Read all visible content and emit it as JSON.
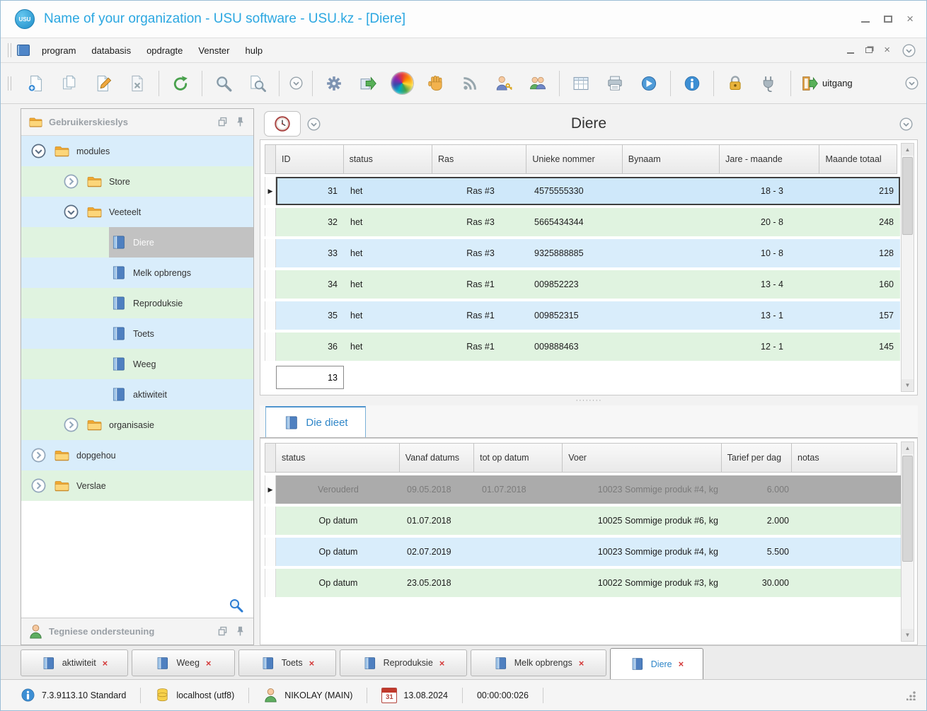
{
  "window": {
    "title": "Name of your organization - USU software - USU.kz - [Diere]",
    "logo_text": "USU"
  },
  "menubar": {
    "items": [
      "program",
      "databasis",
      "opdragte",
      "Venster",
      "hulp"
    ]
  },
  "toolbar": {
    "exit_label": "uitgang"
  },
  "sidebar": {
    "title": "Gebruikerskieslys",
    "support_title": "Tegniese ondersteuning",
    "tree": [
      {
        "label": "modules"
      },
      {
        "label": "Store"
      },
      {
        "label": "Veeteelt"
      },
      {
        "label": "Diere"
      },
      {
        "label": "Melk opbrengs"
      },
      {
        "label": "Reproduksie"
      },
      {
        "label": "Toets"
      },
      {
        "label": "Weeg"
      },
      {
        "label": "aktiwiteit"
      },
      {
        "label": "organisasie"
      },
      {
        "label": "dopgehou"
      },
      {
        "label": "Verslae"
      }
    ]
  },
  "main": {
    "title": "Diere",
    "columns": [
      "ID",
      "status",
      "Ras",
      "Unieke nommer",
      "Bynaam",
      "Jare - maande",
      "Maande totaal"
    ],
    "rows": [
      [
        "31",
        "het",
        "Ras #3",
        "4575555330",
        "",
        "18 - 3",
        "219"
      ],
      [
        "32",
        "het",
        "Ras #3",
        "5665434344",
        "",
        "20 - 8",
        "248"
      ],
      [
        "33",
        "het",
        "Ras #3",
        "9325888885",
        "",
        "10 - 8",
        "128"
      ],
      [
        "34",
        "het",
        "Ras #1",
        "009852223",
        "",
        "13 - 4",
        "160"
      ],
      [
        "35",
        "het",
        "Ras #1",
        "009852315",
        "",
        "13 - 1",
        "157"
      ],
      [
        "36",
        "het",
        "Ras #1",
        "009888463",
        "",
        "12 - 1",
        "145"
      ]
    ],
    "filter_value": "13"
  },
  "detail": {
    "tab_label": "Die dieet",
    "columns": [
      "status",
      "Vanaf datums",
      "tot op datum",
      "Voer",
      "Tarief per dag",
      "notas"
    ],
    "rows": [
      [
        "Verouderd",
        "09.05.2018",
        "01.07.2018",
        "10023 Sommige produk #4, kg",
        "6.000",
        ""
      ],
      [
        "Op datum",
        "01.07.2018",
        "",
        "10025 Sommige produk #6, kg",
        "2.000",
        ""
      ],
      [
        "Op datum",
        "02.07.2019",
        "",
        "10023 Sommige produk #4, kg",
        "5.500",
        ""
      ],
      [
        "Op datum",
        "23.05.2018",
        "",
        "10022 Sommige produk #3, kg",
        "30.000",
        ""
      ]
    ]
  },
  "tabs": {
    "items": [
      "aktiwiteit",
      "Weeg",
      "Toets",
      "Reproduksie",
      "Melk opbrengs",
      "Diere"
    ]
  },
  "statusbar": {
    "version": "7.3.9113.10 Standard",
    "host": "localhost (utf8)",
    "user": "NIKOLAY (MAIN)",
    "calendar_day": "31",
    "date": "13.08.2024",
    "time": "00:00:00:026"
  },
  "colors": {
    "accent_blue": "#2ba7e1",
    "row_blue": "#d9edfb",
    "row_green": "#e0f3e0",
    "selected_gray": "#ababab"
  }
}
